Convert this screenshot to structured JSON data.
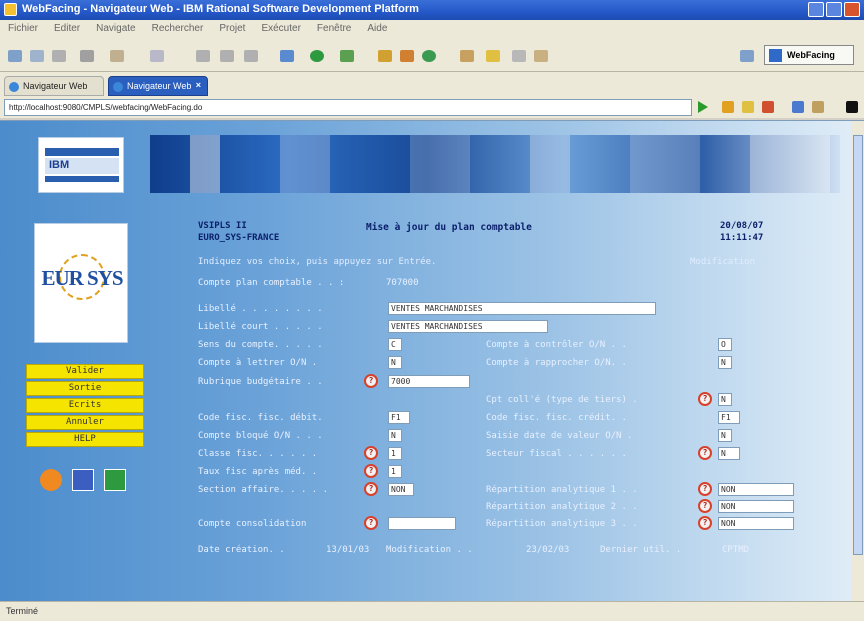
{
  "window": {
    "title": "WebFacing - Navigateur Web - IBM Rational Software Development Platform"
  },
  "menu": [
    "Fichier",
    "Editer",
    "Navigate",
    "Rechercher",
    "Projet",
    "Exécuter",
    "Fenêtre",
    "Aide"
  ],
  "toolbar": {
    "perspective_label": "WebFacing"
  },
  "tabs": [
    {
      "label": "Navigateur Web"
    },
    {
      "label": "Navigateur Web"
    }
  ],
  "address": {
    "url": "http://localhost:9080/CMPLS/webfacing/WebFacing.do"
  },
  "logos": {
    "ibm": "IBM",
    "euro": "EUR   SYS"
  },
  "function_keys": [
    "Valider",
    "Sortie",
    "Ecrits",
    "Annuler",
    "HELP"
  ],
  "form": {
    "header_left_1": "VSIPLS II",
    "header_left_2": "EURO_SYS-FRANCE",
    "title": "Mise à jour du plan comptable",
    "date": "20/08/07",
    "time": "11:11:47",
    "instructions": "Indiquez vos choix, puis appuyez sur Entrée.",
    "mode": "Modification",
    "account_label": "Compte plan comptable  . . :",
    "account_value": "707000",
    "rows": {
      "libelle_label": "Libellé . . . . . . . .",
      "libelle_value": "VENTES MARCHANDISES",
      "libelle_court_label": "Libellé court . . . . .",
      "libelle_court_value": "VENTES MARCHANDISES",
      "sens_label": "Sens du compte. . . . .",
      "sens_value": "C",
      "controler_label": "Compte à contrôler O/N . .",
      "controler_value": "O",
      "lettrer_label": "Compte à lettrer O/N  .",
      "lettrer_value": "N",
      "rapprocher_label": "Compte à rapprocher O/N. .",
      "rapprocher_value": "N",
      "rubrique_label": "Rubrique budgétaire  . .",
      "rubrique_value": "7000",
      "cpt_label": "Cpt coll'é (type de tiers) .",
      "cpt_value": "N",
      "debit_label": "Code fisc. fisc. débit.",
      "debit_value": "F1",
      "credit_label": "Code fisc. fisc. crédit. .",
      "credit_value": "F1",
      "bloque_label": "Compte bloqué O/N . . .",
      "bloque_value": "N",
      "saisie_label": "Saisie date de valeur O/N .",
      "saisie_value": "N",
      "classe_label": "Classe fisc. . . . . .",
      "classe_value": "1",
      "secteur_label": "Secteur fiscal . . . . . .",
      "secteur_value": "N",
      "taux_label": "Taux fisc après méd. .",
      "taux_value": "1",
      "section_label": "Section affaire. . . . .",
      "section_value": "NON",
      "rep1_label": "Répartition analytique 1 . .",
      "rep1_value": "NON",
      "rep2_label": "Répartition analytique 2 . .",
      "rep2_value": "NON",
      "rep3_label": "Répartition analytique 3 . .",
      "rep3_value": "NON",
      "consolidation_label": "Compte consolidation",
      "consolidation_value": ""
    },
    "footer": {
      "creation_label": "Date création. .",
      "creation_value": "13/01/03",
      "modification_label": "Modification . .",
      "modification_value": "23/02/03",
      "user_label": "Dernier util. .",
      "user_value": "CPTMD"
    }
  },
  "status": {
    "text": "Terminé"
  },
  "colors": {
    "accent": "#2458c8",
    "fkey": "#f4e400",
    "help_ring": "#d8402a"
  }
}
